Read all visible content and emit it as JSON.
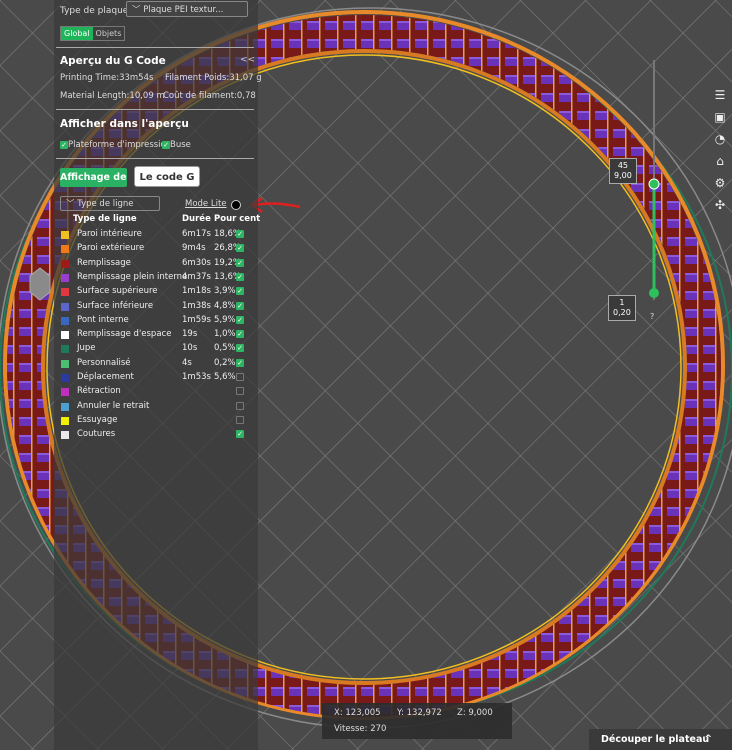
{
  "top": {
    "plate_label": "Type de plaque",
    "plate_value": "Plaque PEI textur...",
    "tabs": [
      "Global",
      "Objets"
    ]
  },
  "preview": {
    "title": "Aperçu du G Code",
    "collapse": "<<",
    "printing_time": "Printing Time:33m54s",
    "filament_weight": "Filament Poids:31,07 g",
    "material_length": "Material Length:10,09 m",
    "filament_cost": "Coût de filament:0,78"
  },
  "display": {
    "title": "Afficher dans l'aperçu",
    "plate_check": "Plateforme d'impressio",
    "nozzle_check": "Buse"
  },
  "buttons": {
    "display_btn": "Affichage des",
    "gcode_btn": "Le code G"
  },
  "linetype": {
    "selector": "Type de ligne",
    "mode_lite": "Mode Lite",
    "headers": {
      "type": "Type de ligne",
      "duration": "Durée",
      "percent": "Pour cent"
    },
    "rows": [
      {
        "name": "Paroi intérieure",
        "duration": "6m17s",
        "percent": "18,6%",
        "checked": true,
        "color": "#f0c020"
      },
      {
        "name": "Paroi extérieure",
        "duration": "9m4s",
        "percent": "26,8%",
        "checked": true,
        "color": "#f07a1a"
      },
      {
        "name": "Remplissage",
        "duration": "6m30s",
        "percent": "19,2%",
        "checked": true,
        "color": "#a01a1a"
      },
      {
        "name": "Remplissage plein interne",
        "duration": "4m37s",
        "percent": "13,6%",
        "checked": true,
        "color": "#9a3ccc"
      },
      {
        "name": "Surface supérieure",
        "duration": "1m18s",
        "percent": "3,9%",
        "checked": true,
        "color": "#e0383e"
      },
      {
        "name": "Surface inférieure",
        "duration": "1m38s",
        "percent": "4,8%",
        "checked": true,
        "color": "#5a66cc"
      },
      {
        "name": "Pont interne",
        "duration": "1m59s",
        "percent": "5,9%",
        "checked": true,
        "color": "#3a68c0"
      },
      {
        "name": "Remplissage d'espace",
        "duration": "19s",
        "percent": "1,0%",
        "checked": true,
        "color": "#ffffff"
      },
      {
        "name": "Jupe",
        "duration": "10s",
        "percent": "0,5%",
        "checked": true,
        "color": "#1f7a5a"
      },
      {
        "name": "Personnalisé",
        "duration": "4s",
        "percent": "0,2%",
        "checked": true,
        "color": "#4ac070"
      },
      {
        "name": "Déplacement",
        "duration": "1m53s",
        "percent": "5,6%",
        "checked": false,
        "color": "#2a3aa0"
      },
      {
        "name": "Rétraction",
        "duration": "",
        "percent": "",
        "checked": false,
        "color": "#c030c0"
      },
      {
        "name": "Annuler le retrait",
        "duration": "",
        "percent": "",
        "checked": false,
        "color": "#4aa0d0"
      },
      {
        "name": "Essuyage",
        "duration": "",
        "percent": "",
        "checked": false,
        "color": "#f0f000"
      },
      {
        "name": "Coutures",
        "duration": "",
        "percent": "",
        "checked": true,
        "color": "#e8e8e8"
      }
    ]
  },
  "slider": {
    "top_layer": "45",
    "top_height": "9,00",
    "bottom_layer": "1",
    "bottom_height": "0,20",
    "help": "?"
  },
  "status": {
    "x": "X: 123,005",
    "y": "Y: 132,972",
    "z": "Z: 9,000",
    "speed": "Vitesse: 270"
  },
  "slice_button": "Découper le plateau",
  "slice_caret": "^",
  "toolbar": [
    "layers-icon",
    "fit-icon",
    "speed-icon",
    "support-icon",
    "settings-icon",
    "multi-icon"
  ],
  "colors": {
    "accent": "#2ab163"
  }
}
